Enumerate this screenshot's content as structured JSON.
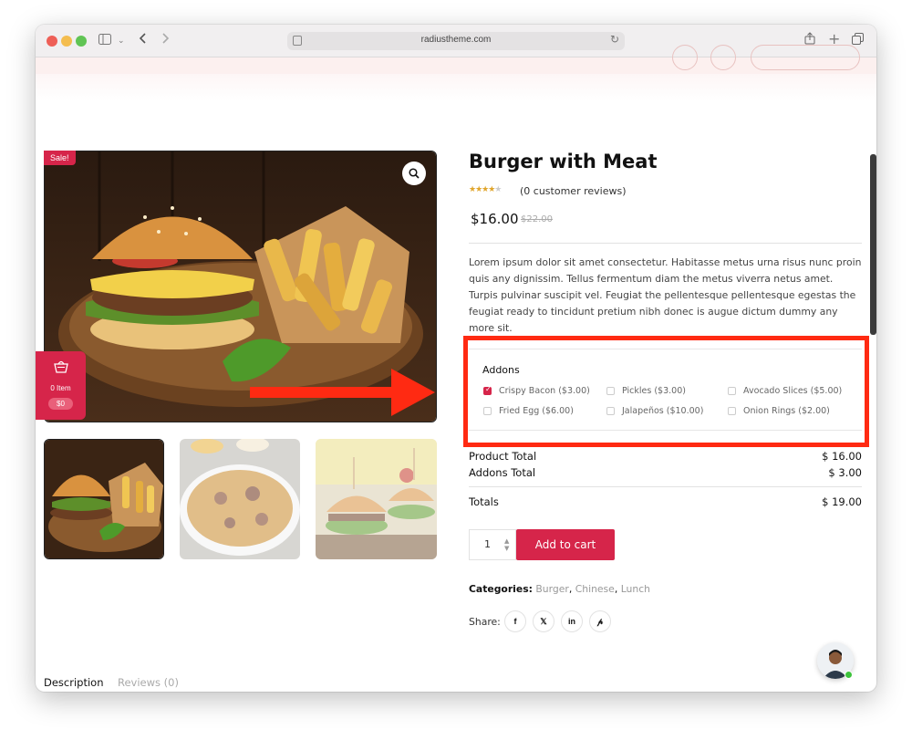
{
  "browser": {
    "url": "radiustheme.com"
  },
  "product": {
    "sale_badge": "Sale!",
    "title": "Burger with Meat",
    "rating": 3.5,
    "reviews_text": "(0 customer reviews)",
    "price": "$16.00",
    "old_price": "$22.00",
    "description": "Lorem ipsum dolor sit amet consectetur. Habitasse metus urna risus nunc proin quis any dignissim. Tellus fermentum diam the metus viverra netus amet. Turpis pulvinar suscipit vel. Feugiat the pellentesque pellentesque egestas the feugiat ready to tincidunt pretium nibh donec is augue dictum dummy any more sit."
  },
  "mini_cart": {
    "count": "0 Item",
    "total": "$0"
  },
  "addons": {
    "title": "Addons",
    "items": [
      {
        "label": "Crispy Bacon ($3.00)",
        "checked": true
      },
      {
        "label": "Pickles ($3.00)",
        "checked": false
      },
      {
        "label": "Avocado Slices ($5.00)",
        "checked": false
      },
      {
        "label": "Fried Egg ($6.00)",
        "checked": false
      },
      {
        "label": "Jalapeños ($10.00)",
        "checked": false
      },
      {
        "label": "Onion Rings ($2.00)",
        "checked": false
      }
    ]
  },
  "totals": {
    "product_label": "Product Total",
    "product_value": "$ 16.00",
    "addons_label": "Addons Total",
    "addons_value": "$ 3.00",
    "total_label": "Totals",
    "total_value": "$ 19.00"
  },
  "cart": {
    "quantity": "1",
    "add_label": "Add to cart"
  },
  "meta": {
    "categories_label": "Categories:",
    "categories": [
      "Burger",
      "Chinese",
      "Lunch"
    ],
    "share_label": "Share:",
    "share_icons": [
      "facebook-icon",
      "x-icon",
      "linkedin-icon",
      "pinterest-icon"
    ]
  },
  "tabs": {
    "description": "Description",
    "reviews": "Reviews (0)"
  },
  "colors": {
    "accent": "#d6254a",
    "annotation": "#ff2a12"
  }
}
